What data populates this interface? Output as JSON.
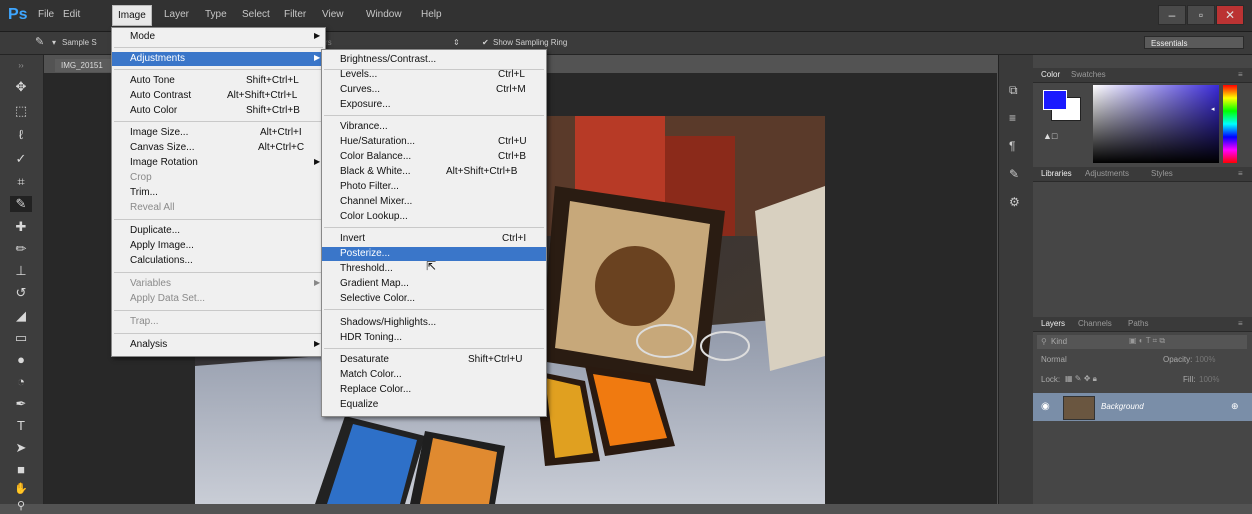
{
  "app": {
    "logo": "Ps"
  },
  "menubar": {
    "items": [
      "File",
      "Edit",
      "Image",
      "Layer",
      "Type",
      "Select",
      "Filter",
      "View",
      "Window",
      "Help"
    ],
    "active": "Image",
    "window_buttons": [
      "–",
      "▫",
      "✕"
    ]
  },
  "options_bar": {
    "sample_label": "Sample S",
    "show_sampling_ring": "Show Sampling Ring",
    "workspace": "Essentials"
  },
  "document": {
    "tab_label": "IMG_20151"
  },
  "image_menu": [
    {
      "label": "Mode",
      "submenu": true
    },
    {
      "label": "Adjustments",
      "submenu": true,
      "highlighted": true
    },
    {
      "label": "Auto Tone",
      "shortcut": "Shift+Ctrl+L"
    },
    {
      "label": "Auto Contrast",
      "shortcut": "Alt+Shift+Ctrl+L"
    },
    {
      "label": "Auto Color",
      "shortcut": "Shift+Ctrl+B"
    },
    {
      "label": "Image Size...",
      "shortcut": "Alt+Ctrl+I"
    },
    {
      "label": "Canvas Size...",
      "shortcut": "Alt+Ctrl+C"
    },
    {
      "label": "Image Rotation",
      "submenu": true
    },
    {
      "label": "Crop",
      "disabled": true
    },
    {
      "label": "Trim..."
    },
    {
      "label": "Reveal All",
      "disabled": true
    },
    {
      "label": "Duplicate..."
    },
    {
      "label": "Apply Image..."
    },
    {
      "label": "Calculations..."
    },
    {
      "label": "Variables",
      "submenu": true,
      "disabled": true
    },
    {
      "label": "Apply Data Set...",
      "disabled": true
    },
    {
      "label": "Trap...",
      "disabled": true
    },
    {
      "label": "Analysis",
      "submenu": true
    }
  ],
  "adjustments_menu": [
    {
      "label": "Brightness/Contrast..."
    },
    {
      "label": "Levels...",
      "shortcut": "Ctrl+L"
    },
    {
      "label": "Curves...",
      "shortcut": "Ctrl+M"
    },
    {
      "label": "Exposure..."
    },
    {
      "label": "Vibrance..."
    },
    {
      "label": "Hue/Saturation...",
      "shortcut": "Ctrl+U"
    },
    {
      "label": "Color Balance...",
      "shortcut": "Ctrl+B"
    },
    {
      "label": "Black & White...",
      "shortcut": "Alt+Shift+Ctrl+B"
    },
    {
      "label": "Photo Filter..."
    },
    {
      "label": "Channel Mixer..."
    },
    {
      "label": "Color Lookup..."
    },
    {
      "label": "Invert",
      "shortcut": "Ctrl+I"
    },
    {
      "label": "Posterize...",
      "highlighted": true
    },
    {
      "label": "Threshold..."
    },
    {
      "label": "Gradient Map..."
    },
    {
      "label": "Selective Color..."
    },
    {
      "label": "Shadows/Highlights..."
    },
    {
      "label": "HDR Toning..."
    },
    {
      "label": "Desaturate",
      "shortcut": "Shift+Ctrl+U"
    },
    {
      "label": "Match Color..."
    },
    {
      "label": "Replace Color..."
    },
    {
      "label": "Equalize"
    }
  ],
  "color_panel": {
    "tabs": [
      "Color",
      "Swatches"
    ],
    "foreground": "#1a1aff",
    "background": "#ffffff"
  },
  "libraries_panel": {
    "tabs": [
      "Libraries",
      "Adjustments",
      "Styles"
    ]
  },
  "layers_panel": {
    "tabs": [
      "Layers",
      "Channels",
      "Paths"
    ],
    "kind_label": "Kind",
    "blend_mode": "Normal",
    "opacity_label": "Opacity:",
    "opacity_value": "100%",
    "lock_label": "Lock:",
    "fill_label": "Fill:",
    "fill_value": "100%",
    "layer_name": "Background"
  },
  "colors": {
    "menubar": "#323232",
    "highlight": "#3a76c9",
    "layer_selected": "#7a8ea8"
  }
}
